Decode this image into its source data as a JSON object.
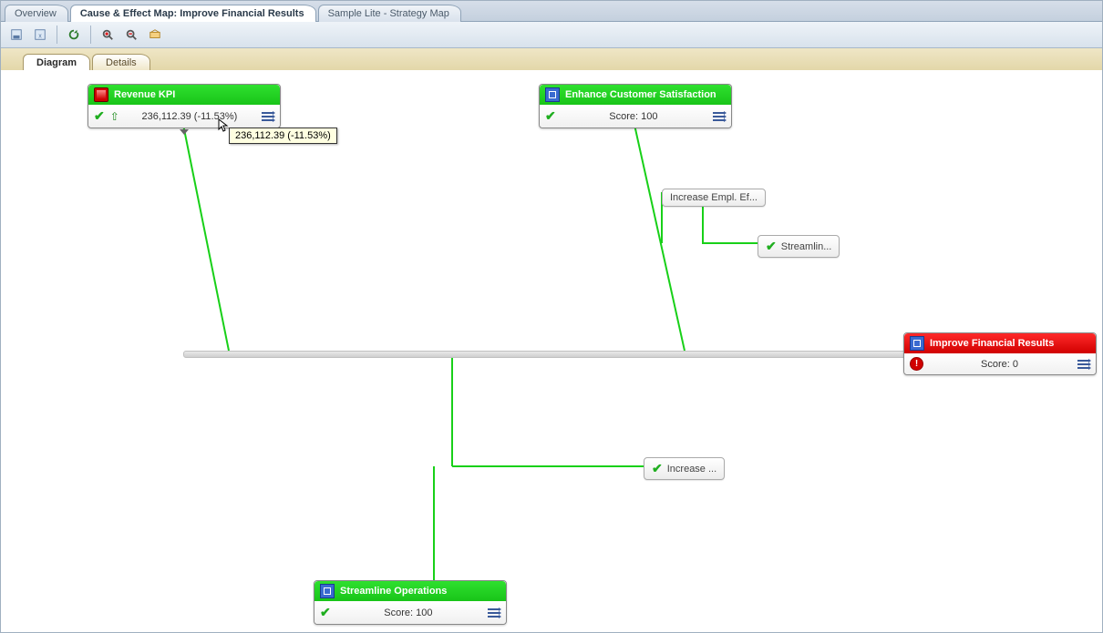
{
  "top_tabs": {
    "overview": "Overview",
    "map": "Cause & Effect Map: Improve Financial Results",
    "sample": "Sample Lite - Strategy Map"
  },
  "sub_tabs": {
    "diagram": "Diagram",
    "details": "Details"
  },
  "nodes": {
    "revenue": {
      "title": "Revenue KPI",
      "value": "236,112.39 (-11.53%)"
    },
    "enhance": {
      "title": "Enhance Customer Satisfaction",
      "score": "Score: 100"
    },
    "improve": {
      "title": "Improve Financial Results",
      "score": "Score: 0"
    },
    "streamline": {
      "title": "Streamline Operations",
      "score": "Score: 100"
    }
  },
  "minis": {
    "incr_empl": "Increase Empl. Ef...",
    "streamlin": "Streamlin...",
    "increase": "Increase ..."
  },
  "tooltip": "236,112.39 (-11.53%)"
}
